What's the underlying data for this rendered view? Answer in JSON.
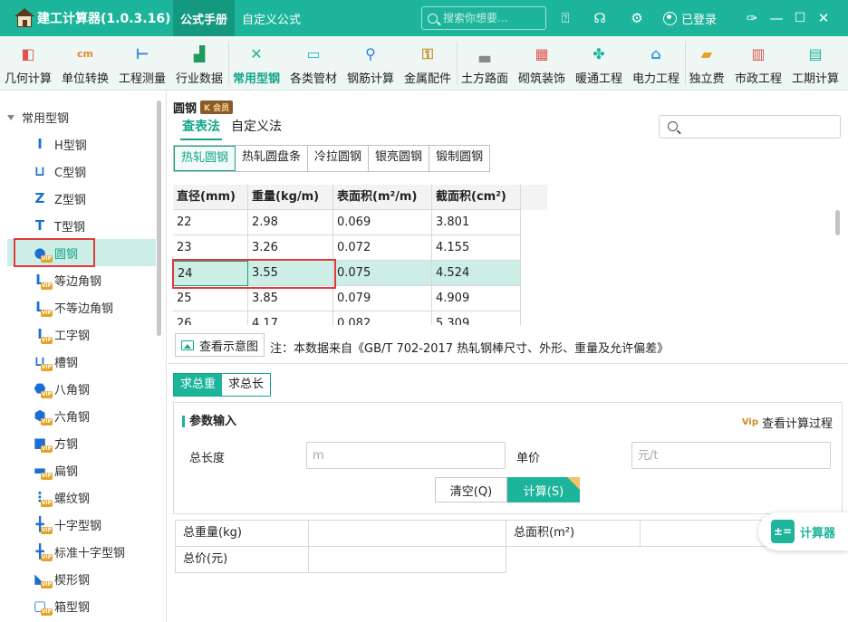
{
  "app": {
    "title": "建工计算器(1.0.3.16)",
    "tabs": [
      {
        "label": "公式手册",
        "active": true
      },
      {
        "label": "自定义公式",
        "active": false
      }
    ],
    "search_placeholder": "搜索你想要...",
    "login_label": "已登录",
    "accent_color": "#1cb59b"
  },
  "ribbon": {
    "items": [
      {
        "label": "几何计算",
        "icon": "cube-icon",
        "color": "#e0524c"
      },
      {
        "label": "单位转换",
        "icon": "unit-convert-icon",
        "color": "#e8862b"
      },
      {
        "label": "工程测量",
        "icon": "measure-icon",
        "color": "#2b7ddc"
      },
      {
        "label": "行业数据",
        "icon": "bar-chart-icon",
        "color": "#1e9c5c"
      },
      {
        "label": "常用型钢",
        "icon": "tools-icon",
        "color": "#1cb59b",
        "active": true
      },
      {
        "label": "各类管材",
        "icon": "pipe-icon",
        "color": "#2bb6c9"
      },
      {
        "label": "钢筋计算",
        "icon": "rebar-icon",
        "color": "#2b7ddc"
      },
      {
        "label": "金属配件",
        "icon": "metal-part-icon",
        "color": "#c88a1f"
      },
      {
        "label": "土方路面",
        "icon": "road-icon",
        "color": "#8a8a8a"
      },
      {
        "label": "砌筑装饰",
        "icon": "brick-icon",
        "color": "#e0524c"
      },
      {
        "label": "暖通工程",
        "icon": "fan-icon",
        "color": "#1cb59b"
      },
      {
        "label": "电力工程",
        "icon": "power-icon",
        "color": "#2b9bdc"
      },
      {
        "label": "独立费",
        "icon": "fee-chart-icon",
        "color": "#e3a327"
      },
      {
        "label": "市政工程",
        "icon": "municipal-icon",
        "color": "#e0524c"
      },
      {
        "label": "工期计算",
        "icon": "calendar-icon",
        "color": "#1cb59b"
      }
    ]
  },
  "sidebar": {
    "root_label": "常用型钢",
    "items": [
      {
        "label": "H型钢",
        "icon": "h-beam-icon",
        "glyph": "I"
      },
      {
        "label": "C型钢",
        "icon": "c-channel-icon",
        "glyph": "⊔"
      },
      {
        "label": "Z型钢",
        "icon": "z-section-icon",
        "glyph": "Z"
      },
      {
        "label": "T型钢",
        "icon": "t-section-icon",
        "glyph": "T"
      },
      {
        "label": "圆钢",
        "icon": "round-bar-icon",
        "glyph": "●",
        "active": true,
        "vip": true
      },
      {
        "label": "等边角钢",
        "icon": "equal-angle-icon",
        "glyph": "L",
        "vip": true
      },
      {
        "label": "不等边角钢",
        "icon": "unequal-angle-icon",
        "glyph": "L",
        "vip": true
      },
      {
        "label": "工字钢",
        "icon": "i-beam-icon",
        "glyph": "I",
        "vip": true
      },
      {
        "label": "槽钢",
        "icon": "channel-icon",
        "glyph": "⊔",
        "vip": true
      },
      {
        "label": "八角钢",
        "icon": "octagon-bar-icon",
        "glyph": "⬣",
        "vip": true
      },
      {
        "label": "六角钢",
        "icon": "hexagon-bar-icon",
        "glyph": "⬢",
        "vip": true
      },
      {
        "label": "方钢",
        "icon": "square-bar-icon",
        "glyph": "■",
        "vip": true
      },
      {
        "label": "扁钢",
        "icon": "flat-bar-icon",
        "glyph": "▬",
        "vip": true
      },
      {
        "label": "螺纹钢",
        "icon": "rebar-thread-icon",
        "glyph": "⋮",
        "vip": true
      },
      {
        "label": "十字型钢",
        "icon": "cross-section-icon",
        "glyph": "╋",
        "vip": true
      },
      {
        "label": "标准十字型钢",
        "icon": "std-cross-section-icon",
        "glyph": "╋",
        "vip": true
      },
      {
        "label": "楔形钢",
        "icon": "wedge-bar-icon",
        "glyph": "◣",
        "vip": true
      },
      {
        "label": "箱型钢",
        "icon": "box-section-icon",
        "glyph": "▢",
        "vip": true
      }
    ]
  },
  "main": {
    "title": "圆钢",
    "badge": "K 会员",
    "method_tabs": [
      {
        "label": "查表法",
        "active": true
      },
      {
        "label": "自定义法",
        "active": false
      }
    ],
    "sub_tabs": [
      {
        "label": "热轧圆钢",
        "active": true
      },
      {
        "label": "热轧圆盘条",
        "active": false
      },
      {
        "label": "冷拉圆钢",
        "active": false
      },
      {
        "label": "银亮圆钢",
        "active": false
      },
      {
        "label": "锻制圆钢",
        "active": false
      }
    ],
    "table": {
      "columns": [
        "直径(mm)",
        "重量(kg/m)",
        "表面积(m²/m)",
        "截面积(cm²)"
      ],
      "rows": [
        [
          "22",
          "2.98",
          "0.069",
          "3.801"
        ],
        [
          "23",
          "3.26",
          "0.072",
          "4.155"
        ],
        [
          "24",
          "3.55",
          "0.075",
          "4.524"
        ],
        [
          "25",
          "3.85",
          "0.079",
          "4.909"
        ],
        [
          "26",
          "4.17",
          "0.082",
          "5.309"
        ]
      ],
      "selected_row": 2
    },
    "view_diagram_label": "查看示意图",
    "note": "注：本数据来自《GB/T 702-2017 热轧钢棒尺寸、外形、重量及允许偏差》",
    "calc_tabs": [
      {
        "label": "求总重",
        "active": true
      },
      {
        "label": "求总长",
        "active": false
      }
    ],
    "params": {
      "title": "参数输入",
      "process_link": "查看计算过程",
      "length_label": "总长度",
      "length_value": "",
      "length_placeholder": "m",
      "price_label": "单价",
      "price_value": "",
      "price_placeholder": "元/t",
      "clear_label": "清空(Q)",
      "calc_label": "计算(S)"
    },
    "results": {
      "weight_label": "总重量(kg)",
      "weight_value": "",
      "area_label": "总面积(m²)",
      "area_value": "",
      "price_label": "总价(元)",
      "price_value": ""
    },
    "float_calc_label": "计算器"
  }
}
